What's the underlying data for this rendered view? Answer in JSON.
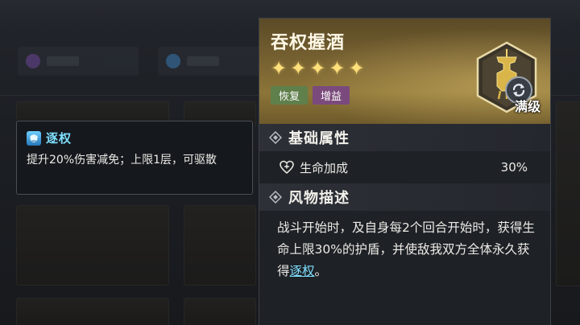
{
  "tooltip": {
    "title": "逐权",
    "description": "提升20%伤害减免；上限1层，可驱散",
    "icon": "shield-buff-icon",
    "title_color": "#7fe0ff"
  },
  "relic": {
    "name": "吞权握酒",
    "stars": [
      "✦",
      "✦",
      "✦",
      "✦",
      "✦"
    ],
    "tags": [
      "恢复",
      "增益"
    ],
    "level_label": "满级",
    "emblem": "wine-vessel-icon"
  },
  "sections": {
    "base_attributes": {
      "title": "基础属性",
      "attribute_name": "生命加成",
      "attribute_value": "30%"
    },
    "description": {
      "title": "风物描述",
      "text_before": "战斗开始时，及自身每2个回合开始时，获得生命上限30%的护盾，并使敌我双方全体永久获得",
      "link_text": "逐权",
      "text_after": "。"
    }
  },
  "colors": {
    "accent": "#7fe0ff",
    "gold": "#ffe07a",
    "tag_restore": "#5f7f4b",
    "tag_buff": "#7b4a7c"
  }
}
